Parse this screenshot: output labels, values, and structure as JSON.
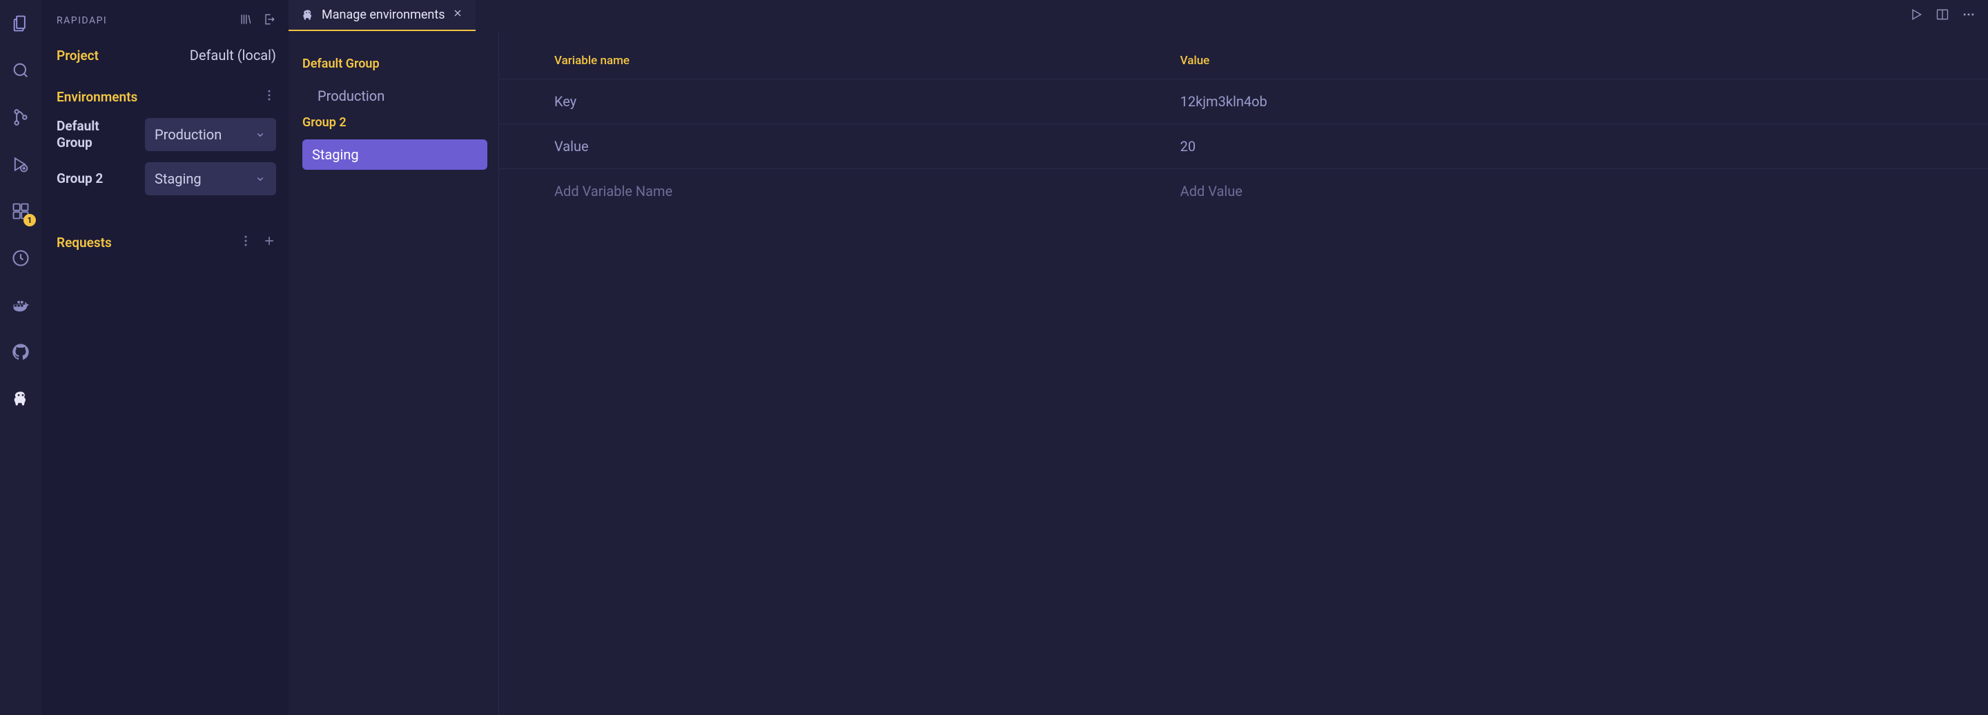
{
  "activityBar": {
    "badgeCount": "1"
  },
  "sidebar": {
    "title": "RAPIDAPI",
    "project": {
      "label": "Project",
      "value": "Default (local)"
    },
    "environments": {
      "label": "Environments",
      "groups": [
        {
          "name": "Default Group",
          "selected": "Production"
        },
        {
          "name": "Group 2",
          "selected": "Staging"
        }
      ]
    },
    "requests": {
      "label": "Requests"
    }
  },
  "tab": {
    "title": "Manage environments"
  },
  "envPanel": {
    "groups": [
      {
        "label": "Default Group",
        "items": [
          {
            "name": "Production",
            "selected": false
          }
        ]
      },
      {
        "label": "Group 2",
        "items": [
          {
            "name": "Staging",
            "selected": true
          }
        ]
      }
    ]
  },
  "varsTable": {
    "headers": {
      "name": "Variable name",
      "value": "Value"
    },
    "rows": [
      {
        "name": "Key",
        "value": "12kjm3kln4ob"
      },
      {
        "name": "Value",
        "value": "20"
      }
    ],
    "placeholder": {
      "name": "Add Variable Name",
      "value": "Add Value"
    }
  }
}
